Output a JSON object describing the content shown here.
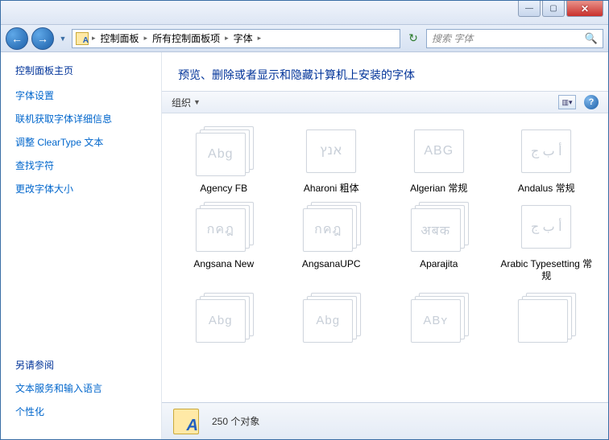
{
  "titlebar": {
    "min": "—",
    "max": "▢",
    "close": "✕"
  },
  "nav": {
    "back": "←",
    "fwd": "→",
    "drop": "▼",
    "crumbs": [
      "控制面板",
      "所有控制面板项",
      "字体"
    ],
    "refresh": "↻",
    "search_placeholder": "搜索 字体",
    "search_icon": "🔍"
  },
  "sidebar": {
    "head": "控制面板主页",
    "links": [
      "字体设置",
      "联机获取字体详细信息",
      "调整 ClearType 文本",
      "查找字符",
      "更改字体大小"
    ],
    "also_head": "另请参阅",
    "also_links": [
      "文本服务和输入语言",
      "个性化"
    ]
  },
  "main": {
    "heading": "预览、删除或者显示和隐藏计算机上安装的字体",
    "organize": "组织",
    "organize_drop": "▼",
    "view_drop": "▾",
    "help": "?"
  },
  "fonts": [
    {
      "label": "Agency FB",
      "sample": "Abg",
      "single": false
    },
    {
      "label": "Aharoni 粗体",
      "sample": "אנץ",
      "single": true
    },
    {
      "label": "Algerian 常规",
      "sample": "ABG",
      "single": true
    },
    {
      "label": "Andalus 常规",
      "sample": "أ ب ج",
      "single": true
    },
    {
      "label": "Angsana New",
      "sample": "กคฎ",
      "single": false
    },
    {
      "label": "AngsanaUPC",
      "sample": "กคฎ",
      "single": false
    },
    {
      "label": "Aparajita",
      "sample": "अबक",
      "single": false
    },
    {
      "label": "Arabic Typesetting 常规",
      "sample": "أ ب ج",
      "single": true
    }
  ],
  "partial": [
    {
      "sample": "Abg"
    },
    {
      "sample": "Abg"
    },
    {
      "sample": "ABʏ"
    },
    {
      "sample": ""
    }
  ],
  "status": {
    "count": "250 个对象"
  }
}
